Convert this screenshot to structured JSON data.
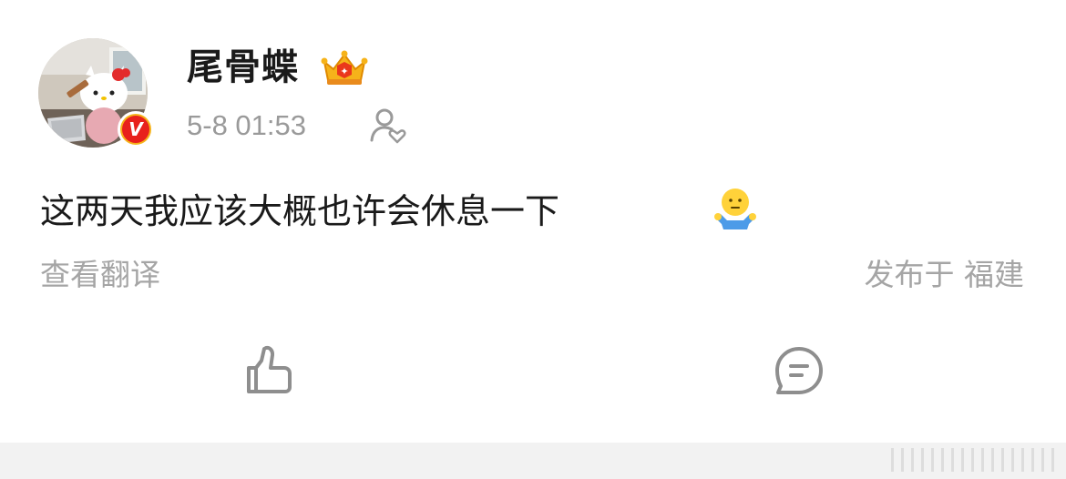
{
  "post": {
    "author": {
      "name": "尾骨蝶",
      "avatar_icon": "hello-kitty-avatar",
      "verified_badge_text": "V",
      "verified_badge_color": "#e8211c",
      "membership_icon": "crown-icon"
    },
    "timestamp": "5-8 01:53",
    "visibility_icon": "user-heart-icon",
    "content": "这两天我应该大概也许会休息一下",
    "content_emoji": "shrug-emoji-icon",
    "translate_label": "查看翻译",
    "location_label": "发布于 福建"
  },
  "actions": {
    "like_icon": "thumbs-up-icon",
    "comment_icon": "comment-icon"
  },
  "colors": {
    "text_primary": "#1a1a1a",
    "text_secondary": "#9a9a9a",
    "accent_gold": "#f6b31a",
    "icon_gray": "#8e8e8e"
  }
}
